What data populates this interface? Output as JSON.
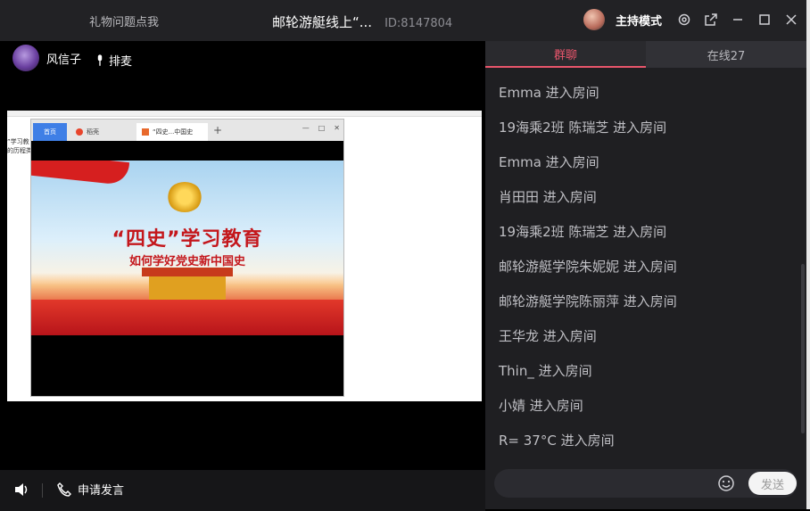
{
  "titlebar": {
    "gift_help": "礼物问题点我",
    "room_title": "邮轮游艇线上“...",
    "room_id": "ID:8147804",
    "host_mode": "主持模式"
  },
  "stage": {
    "presenter_name": "风信子",
    "queue_label": "排麦",
    "apply_speak": "申请发言"
  },
  "shared_screen": {
    "side_text_1": "”学习教",
    "side_text_2": "的历程类",
    "browser_tabs": [
      "首页",
      "稻壳",
      "“四史...中国史"
    ],
    "slide_title": "“四史”学习教育",
    "slide_subtitle": "如何学好党史新中国史"
  },
  "chat": {
    "tab_group": "群聊",
    "tab_online": "在线27",
    "messages": [
      "Emma 进入房间",
      "19海乘2班 陈瑞芝 进入房间",
      "Emma 进入房间",
      "肖田田 进入房间",
      "19海乘2班 陈瑞芝 进入房间",
      "邮轮游艇学院朱妮妮 进入房间",
      "邮轮游艇学院陈丽萍 进入房间",
      "王华龙 进入房间",
      "Thin_ 进入房间",
      "小婧 进入房间",
      "R= 37°C 进入房间"
    ],
    "send_label": "发送"
  },
  "colors": {
    "accent": "#e9566c",
    "titlebar_bg": "#222225",
    "chat_bg": "#1f1f22"
  }
}
